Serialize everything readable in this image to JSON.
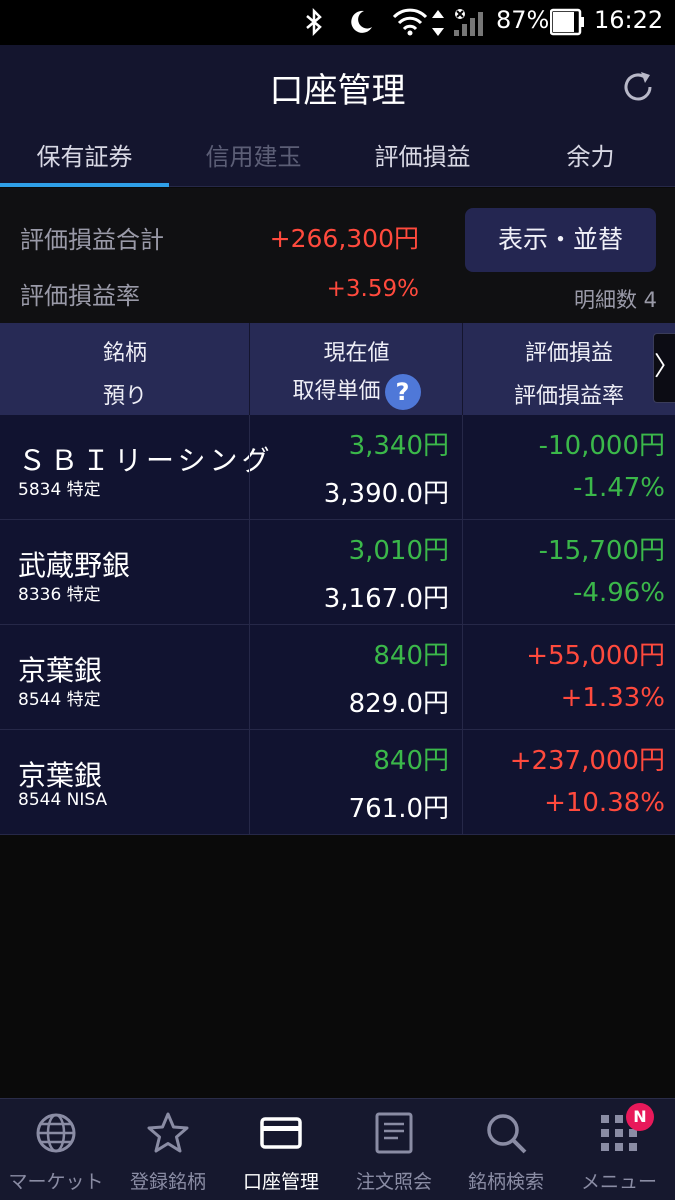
{
  "status_bar": {
    "battery_percent": "87%",
    "time": "16:22",
    "icons": [
      "bluetooth-icon",
      "moon-icon",
      "wifi-icon",
      "data-arrows-icon",
      "signal-icon",
      "battery-icon"
    ]
  },
  "header": {
    "title": "口座管理",
    "refresh_icon": "refresh-icon"
  },
  "tabs": [
    {
      "label": "保有証券",
      "active": true
    },
    {
      "label": "信用建玉",
      "disabled": true
    },
    {
      "label": "評価損益"
    },
    {
      "label": "余力"
    }
  ],
  "summary": {
    "total_pl_label": "評価損益合計",
    "total_pl_value": "+266,300円",
    "pl_rate_label": "評価損益率",
    "pl_rate_value": "+3.59%",
    "display_button": "表示・並替",
    "count_label": "明細数 4"
  },
  "table_header": {
    "col1_top": "銘柄",
    "col1_bottom": "預り",
    "col2_top": "現在値",
    "col2_bottom": "取得単価",
    "col3_top": "評価損益",
    "col3_bottom": "評価損益率",
    "help_glyph": "?",
    "scroll_glyph": "〉"
  },
  "holdings": [
    {
      "name": "ＳＢＩリーシング",
      "sub": "5834 特定",
      "price": "3,340円",
      "cost": "3,390.0円",
      "pl": "-10,000円",
      "pl_rate": "-1.47%",
      "pl_sign": "neg"
    },
    {
      "name": "武蔵野銀",
      "sub": "8336 特定",
      "price": "3,010円",
      "cost": "3,167.0円",
      "pl": "-15,700円",
      "pl_rate": "-4.96%",
      "pl_sign": "neg"
    },
    {
      "name": "京葉銀",
      "sub": "8544 特定",
      "price": "840円",
      "cost": "829.0円",
      "pl": "+55,000円",
      "pl_rate": "+1.33%",
      "pl_sign": "pos"
    },
    {
      "name": "京葉銀",
      "sub": "8544 NISA",
      "price": "840円",
      "cost": "761.0円",
      "pl": "+237,000円",
      "pl_rate": "+10.38%",
      "pl_sign": "pos"
    }
  ],
  "bottom_nav": [
    {
      "label": "マーケット",
      "icon": "globe-icon"
    },
    {
      "label": "登録銘柄",
      "icon": "star-icon"
    },
    {
      "label": "口座管理",
      "icon": "card-icon",
      "active": true
    },
    {
      "label": "注文照会",
      "icon": "document-icon"
    },
    {
      "label": "銘柄検索",
      "icon": "search-icon"
    },
    {
      "label": "メニュー",
      "icon": "grid-menu-icon",
      "badge": "N"
    }
  ],
  "colors": {
    "positive": "#ff4a3d",
    "negative": "#3bb84a",
    "accent": "#2f9fe8",
    "header_bg": "#14152e"
  }
}
